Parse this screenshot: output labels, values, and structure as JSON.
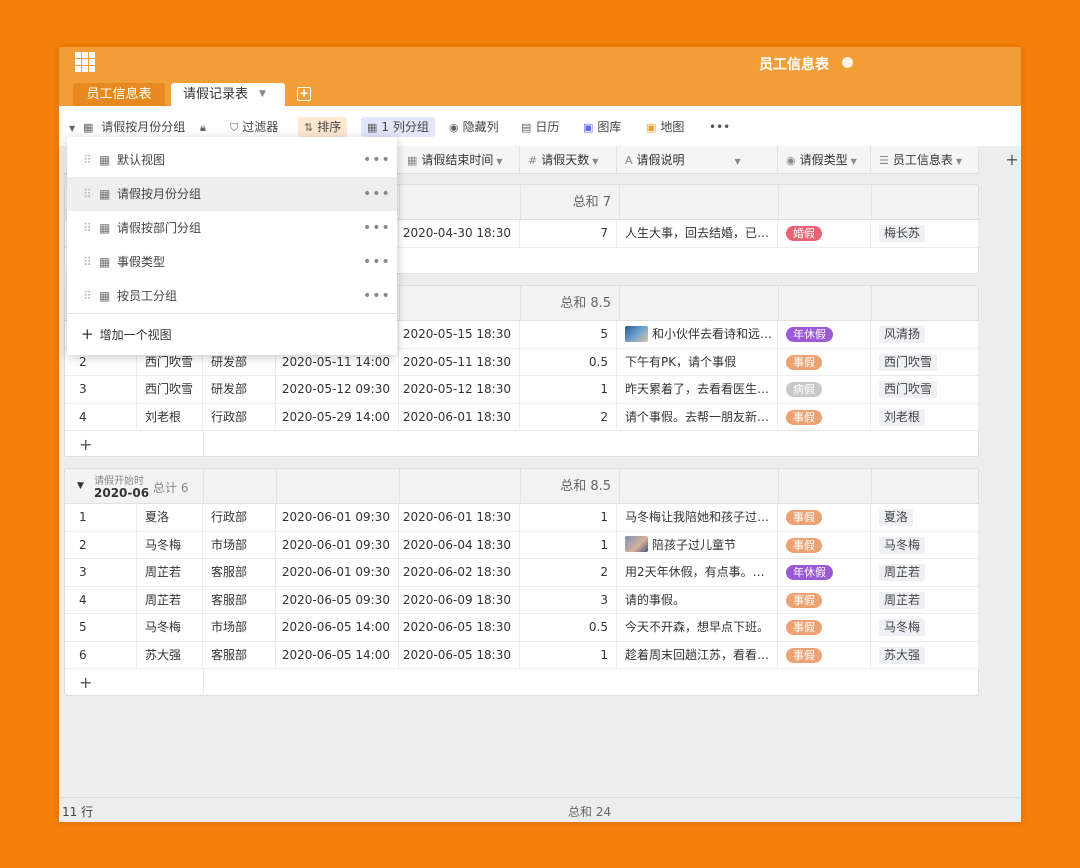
{
  "header": {
    "app_title": "员工信息表",
    "tabs": [
      {
        "label": "员工信息表"
      },
      {
        "label": "请假记录表"
      }
    ],
    "add_tab_label": "+"
  },
  "toolbar": {
    "view_name": "请假按月份分组",
    "filter": "过滤器",
    "sort": "排序",
    "group": "1 列分组",
    "hide_cols": "隐藏列",
    "calendar": "日历",
    "gallery": "图库",
    "map": "地图",
    "more": "•••"
  },
  "view_menu": {
    "items": [
      {
        "label": "默认视图",
        "selected": false
      },
      {
        "label": "请假按月份分组",
        "selected": true
      },
      {
        "label": "请假按部门分组",
        "selected": false
      },
      {
        "label": "事假类型",
        "selected": false
      },
      {
        "label": "按员工分组",
        "selected": false
      }
    ],
    "add_label": "增加一个视图",
    "more": "•••"
  },
  "columns": {
    "end_time": "请假结束时间",
    "days": "请假天数",
    "desc": "请假说明",
    "type": "请假类型",
    "employee": "员工信息表"
  },
  "groups": [
    {
      "sum_label": "总和 7",
      "rows": [
        {
          "index": "",
          "name": "",
          "dept": "",
          "start": "",
          "end": "2020-04-30 18:30",
          "days": "7",
          "desc": "人生大事，回去结婚，已…",
          "type": "婚假",
          "type_class": "tag-hunjia",
          "person": "梅长苏",
          "thumb": ""
        }
      ]
    },
    {
      "sum_label": "总和 8.5",
      "rows": [
        {
          "index": "",
          "name": "",
          "dept": "",
          "start": "",
          "end": "2020-05-15 18:30",
          "days": "5",
          "desc": "和小伙伴去看诗和远…",
          "type": "年休假",
          "type_class": "tag-nianxiujia",
          "person": "风清扬",
          "thumb": "thumb"
        },
        {
          "index": "2",
          "name": "西门吹雪",
          "dept": "研发部",
          "start": "2020-05-11 14:00",
          "end": "2020-05-11 18:30",
          "days": "0.5",
          "desc": "下午有PK，请个事假",
          "type": "事假",
          "type_class": "tag-shijia",
          "person": "西门吹雪",
          "thumb": ""
        },
        {
          "index": "3",
          "name": "西门吹雪",
          "dept": "研发部",
          "start": "2020-05-12 09:30",
          "end": "2020-05-12 18:30",
          "days": "1",
          "desc": "昨天累着了，去看看医生…",
          "type": "病假",
          "type_class": "tag-bingjia",
          "person": "西门吹雪",
          "thumb": ""
        },
        {
          "index": "4",
          "name": "刘老根",
          "dept": "行政部",
          "start": "2020-05-29 14:00",
          "end": "2020-06-01 18:30",
          "days": "2",
          "desc": "请个事假。去帮一朋友新…",
          "type": "事假",
          "type_class": "tag-shijia",
          "person": "刘老根",
          "thumb": ""
        }
      ]
    },
    {
      "group_label": "请假开始时",
      "group_value": "2020-06",
      "count_label": "总计 6",
      "sum_label": "总和 8.5",
      "rows": [
        {
          "index": "1",
          "name": "夏洛",
          "dept": "行政部",
          "start": "2020-06-01 09:30",
          "end": "2020-06-01 18:30",
          "days": "1",
          "desc": "马冬梅让我陪她和孩子过…",
          "type": "事假",
          "type_class": "tag-shijia",
          "person": "夏洛",
          "thumb": ""
        },
        {
          "index": "2",
          "name": "马冬梅",
          "dept": "市场部",
          "start": "2020-06-01 09:30",
          "end": "2020-06-04 18:30",
          "days": "1",
          "desc": "陪孩子过儿童节",
          "type": "事假",
          "type_class": "tag-shijia",
          "person": "马冬梅",
          "thumb": "thumb thumb2"
        },
        {
          "index": "3",
          "name": "周芷若",
          "dept": "客服部",
          "start": "2020-06-01 09:30",
          "end": "2020-06-02 18:30",
          "days": "2",
          "desc": "用2天年休假，有点事。…",
          "type": "年休假",
          "type_class": "tag-nianxiujia",
          "person": "周芷若",
          "thumb": ""
        },
        {
          "index": "4",
          "name": "周芷若",
          "dept": "客服部",
          "start": "2020-06-05 09:30",
          "end": "2020-06-09 18:30",
          "days": "3",
          "desc": "请的事假。",
          "type": "事假",
          "type_class": "tag-shijia",
          "person": "周芷若",
          "thumb": ""
        },
        {
          "index": "5",
          "name": "马冬梅",
          "dept": "市场部",
          "start": "2020-06-05 14:00",
          "end": "2020-06-05 18:30",
          "days": "0.5",
          "desc": "今天不开森，想早点下班。",
          "type": "事假",
          "type_class": "tag-shijia",
          "person": "马冬梅",
          "thumb": ""
        },
        {
          "index": "6",
          "name": "苏大强",
          "dept": "客服部",
          "start": "2020-06-05 14:00",
          "end": "2020-06-05 18:30",
          "days": "1",
          "desc": "趁着周末回趟江苏，看看…",
          "type": "事假",
          "type_class": "tag-shijia",
          "person": "苏大强",
          "thumb": ""
        }
      ]
    }
  ],
  "footer": {
    "row_count": "11 行",
    "total": "总和 24"
  },
  "colors": {
    "background": "#f47f0b",
    "header": "#f19e38",
    "tag_shijia": "#eda274",
    "tag_hunjia": "#ea6174",
    "tag_nianxiujia": "#9b59d6",
    "tag_bingjia": "#c9c9c9"
  }
}
